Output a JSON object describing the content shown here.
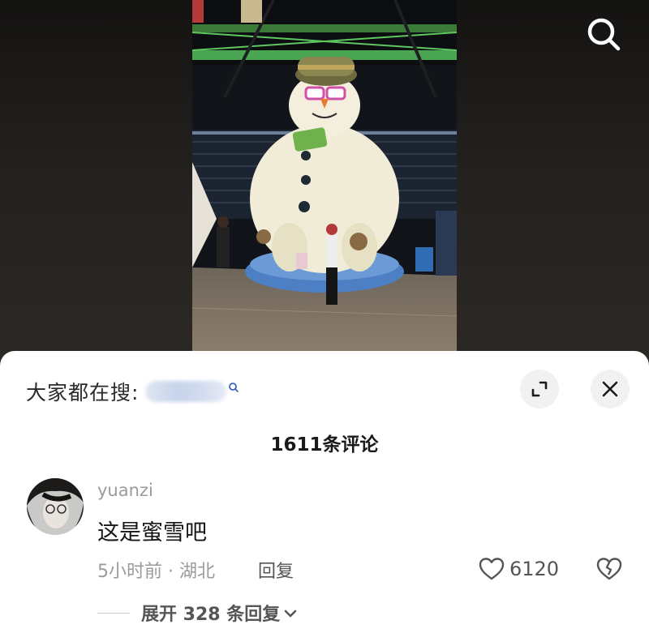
{
  "header": {
    "search_icon": "search-icon"
  },
  "video": {
    "description": ""
  },
  "comments_sheet": {
    "trending_label": "大家都在搜:",
    "expand_icon": "expand-icon",
    "close_icon": "close-icon",
    "comment_count_label": "1611条评论"
  },
  "comment": {
    "username": "yuanzi",
    "text": "这是蜜雪吧",
    "meta": "5小时前 · 湖北",
    "reply_label": "回复",
    "like_count": "6120",
    "expand_replies_label": "展开 328 条回复"
  },
  "colors": {
    "sheet_bg": "#ffffff",
    "backdrop": "#1e1c1b",
    "secondary_text": "#9b9b9b"
  }
}
